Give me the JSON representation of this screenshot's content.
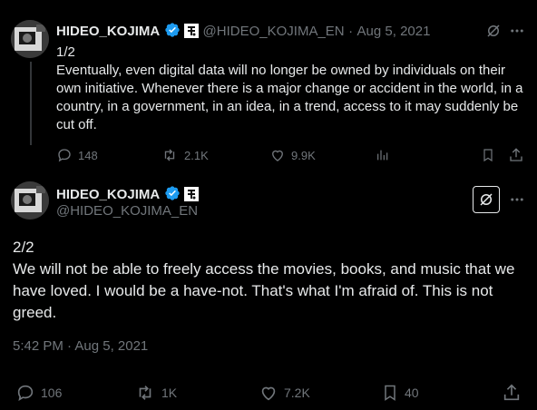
{
  "tweet1": {
    "name": "HIDEO_KOJIMA",
    "handle": "@HIDEO_KOJIMA_EN",
    "separator": "·",
    "date": "Aug 5, 2021",
    "part": "1/2",
    "text": "Eventually, even digital data will no longer be owned by individuals on their own initiative. Whenever there is a major change or accident in the world, in a country, in a government, in an idea, in a trend, access to it may suddenly be cut off.",
    "replies": "148",
    "reposts": "2.1K",
    "likes": "9.9K"
  },
  "tweet2": {
    "name": "HIDEO_KOJIMA",
    "handle": "@HIDEO_KOJIMA_EN",
    "part": "2/2",
    "text": "We will not be able to freely access the movies, books, and music that we have loved. I would be a have-not. That's what I'm afraid of. This is not greed.",
    "timestamp": "5:42 PM · Aug 5, 2021",
    "replies": "106",
    "reposts": "1K",
    "likes": "7.2K",
    "bookmarks": "40"
  },
  "colors": {
    "background": "#000000",
    "text": "#e7e9ea",
    "muted": "#71767b",
    "verified": "#1d9bf0"
  },
  "icons": [
    "avatar",
    "verified-badge-icon",
    "affiliate-badge-icon",
    "grok-icon",
    "more-icon",
    "reply-icon",
    "repost-icon",
    "like-icon",
    "views-icon",
    "bookmark-icon",
    "share-icon"
  ]
}
